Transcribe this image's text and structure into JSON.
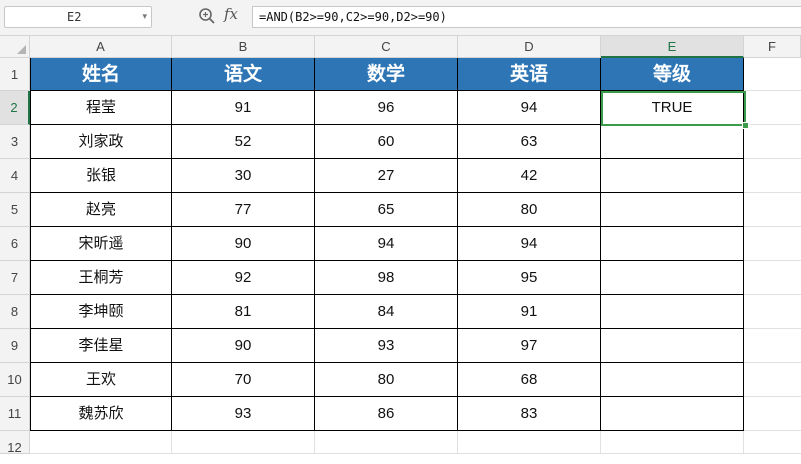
{
  "formula_bar": {
    "name_box": "E2",
    "fx_label": "fx",
    "formula": "=AND(B2>=90,C2>=90,D2>=90)"
  },
  "columns": [
    "A",
    "B",
    "C",
    "D",
    "E",
    "F"
  ],
  "active_column": "E",
  "rows": [
    "1",
    "2",
    "3",
    "4",
    "5",
    "6",
    "7",
    "8",
    "9",
    "10",
    "11",
    "12"
  ],
  "active_row": "2",
  "table": {
    "headers": [
      "姓名",
      "语文",
      "数学",
      "英语",
      "等级"
    ],
    "records": [
      [
        "程莹",
        "91",
        "96",
        "94",
        "TRUE"
      ],
      [
        "刘家政",
        "52",
        "60",
        "63",
        ""
      ],
      [
        "张银",
        "30",
        "27",
        "42",
        ""
      ],
      [
        "赵亮",
        "77",
        "65",
        "80",
        ""
      ],
      [
        "宋昕遥",
        "90",
        "94",
        "94",
        ""
      ],
      [
        "王桐芳",
        "92",
        "98",
        "95",
        ""
      ],
      [
        "李坤颐",
        "81",
        "84",
        "91",
        ""
      ],
      [
        "李佳星",
        "90",
        "93",
        "97",
        ""
      ],
      [
        "王欢",
        "70",
        "80",
        "68",
        ""
      ],
      [
        "魏苏欣",
        "93",
        "86",
        "83",
        ""
      ]
    ]
  },
  "colors": {
    "header_fill": "#2e75b6",
    "header_text": "#ffffff",
    "selection": "#3c9a4b"
  }
}
